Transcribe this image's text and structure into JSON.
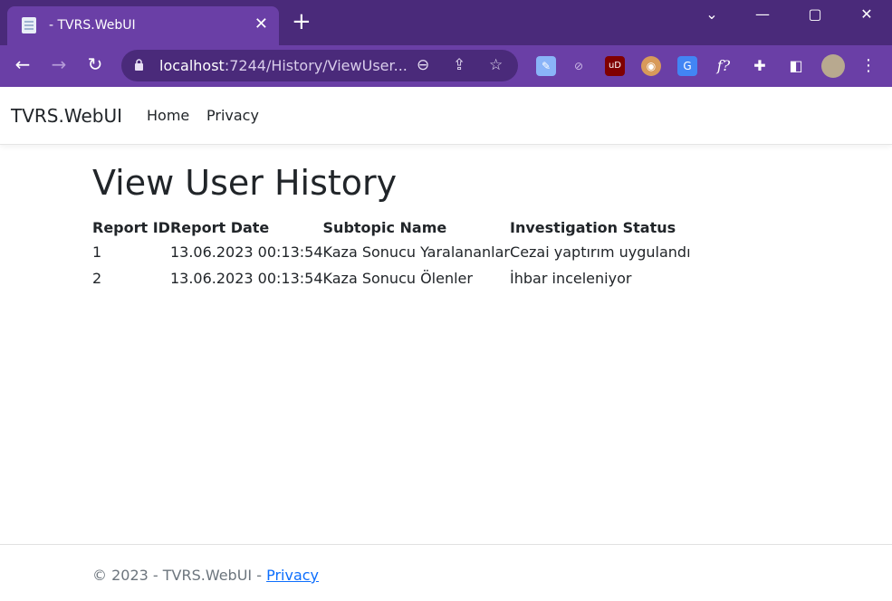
{
  "browser": {
    "tab_title": "- TVRS.WebUI",
    "url_host": "localhost",
    "url_rest": ":7244/History/ViewUser..."
  },
  "site": {
    "brand": "TVRS.WebUI",
    "nav": [
      "Home",
      "Privacy"
    ]
  },
  "page": {
    "title": "View User History",
    "columns": [
      "Report ID",
      "Report Date",
      "Subtopic Name",
      "Investigation Status"
    ],
    "rows": [
      [
        "1",
        "13.06.2023 00:13:54",
        "Kaza Sonucu Yaralananlar",
        "Cezai yaptırım uygulandı"
      ],
      [
        "2",
        "13.06.2023 00:13:54",
        "Kaza Sonucu Ölenler",
        "İhbar inceleniyor"
      ]
    ]
  },
  "footer": {
    "copyright": "© 2023 - TVRS.WebUI - ",
    "privacy_link": "Privacy"
  },
  "colors": {
    "chrome_dark": "#4a2a7a",
    "chrome_light": "#6a3fa6",
    "link": "#0d6efd"
  }
}
